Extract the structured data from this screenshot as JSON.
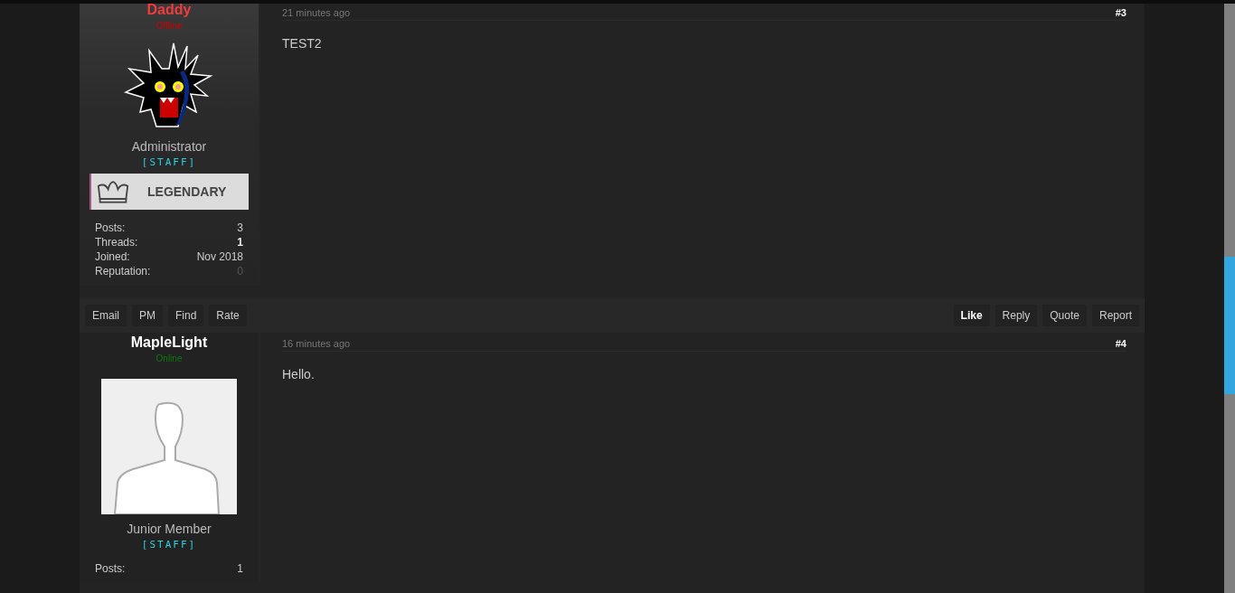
{
  "posts": [
    {
      "author": {
        "name": "Daddy",
        "status": "Offline",
        "online": false,
        "avatar": {
          "kind": "monster"
        },
        "title": "Administrator",
        "group": "[STAFF]",
        "rank_banner": "LEGENDARY",
        "stats": [
          {
            "label": "Posts:",
            "value": "3",
            "kind": "normal"
          },
          {
            "label": "Threads:",
            "value": "1",
            "kind": "bold"
          },
          {
            "label": "Joined:",
            "value": "Nov 2018",
            "kind": "normal"
          },
          {
            "label": "Reputation:",
            "value": "0",
            "kind": "muted"
          }
        ]
      },
      "time": "21 minutes ago",
      "number": "#3",
      "body": "TEST2",
      "left_actions": [
        {
          "label": "Email",
          "emphasized": false
        },
        {
          "label": "PM",
          "emphasized": false
        },
        {
          "label": "Find",
          "emphasized": false
        },
        {
          "label": "Rate",
          "emphasized": false
        }
      ],
      "right_actions": [
        {
          "label": "Like",
          "emphasized": true
        },
        {
          "label": "Reply",
          "emphasized": false
        },
        {
          "label": "Quote",
          "emphasized": false
        },
        {
          "label": "Report",
          "emphasized": false
        }
      ]
    },
    {
      "author": {
        "name": "MapleLight",
        "status": "Online",
        "online": true,
        "avatar": {
          "kind": "default"
        },
        "title": "Junior Member",
        "group": "[STAFF]",
        "stats": [
          {
            "label": "Posts:",
            "value": "1",
            "kind": "normal"
          }
        ]
      },
      "time": "16 minutes ago",
      "number": "#4",
      "body": "Hello."
    }
  ]
}
